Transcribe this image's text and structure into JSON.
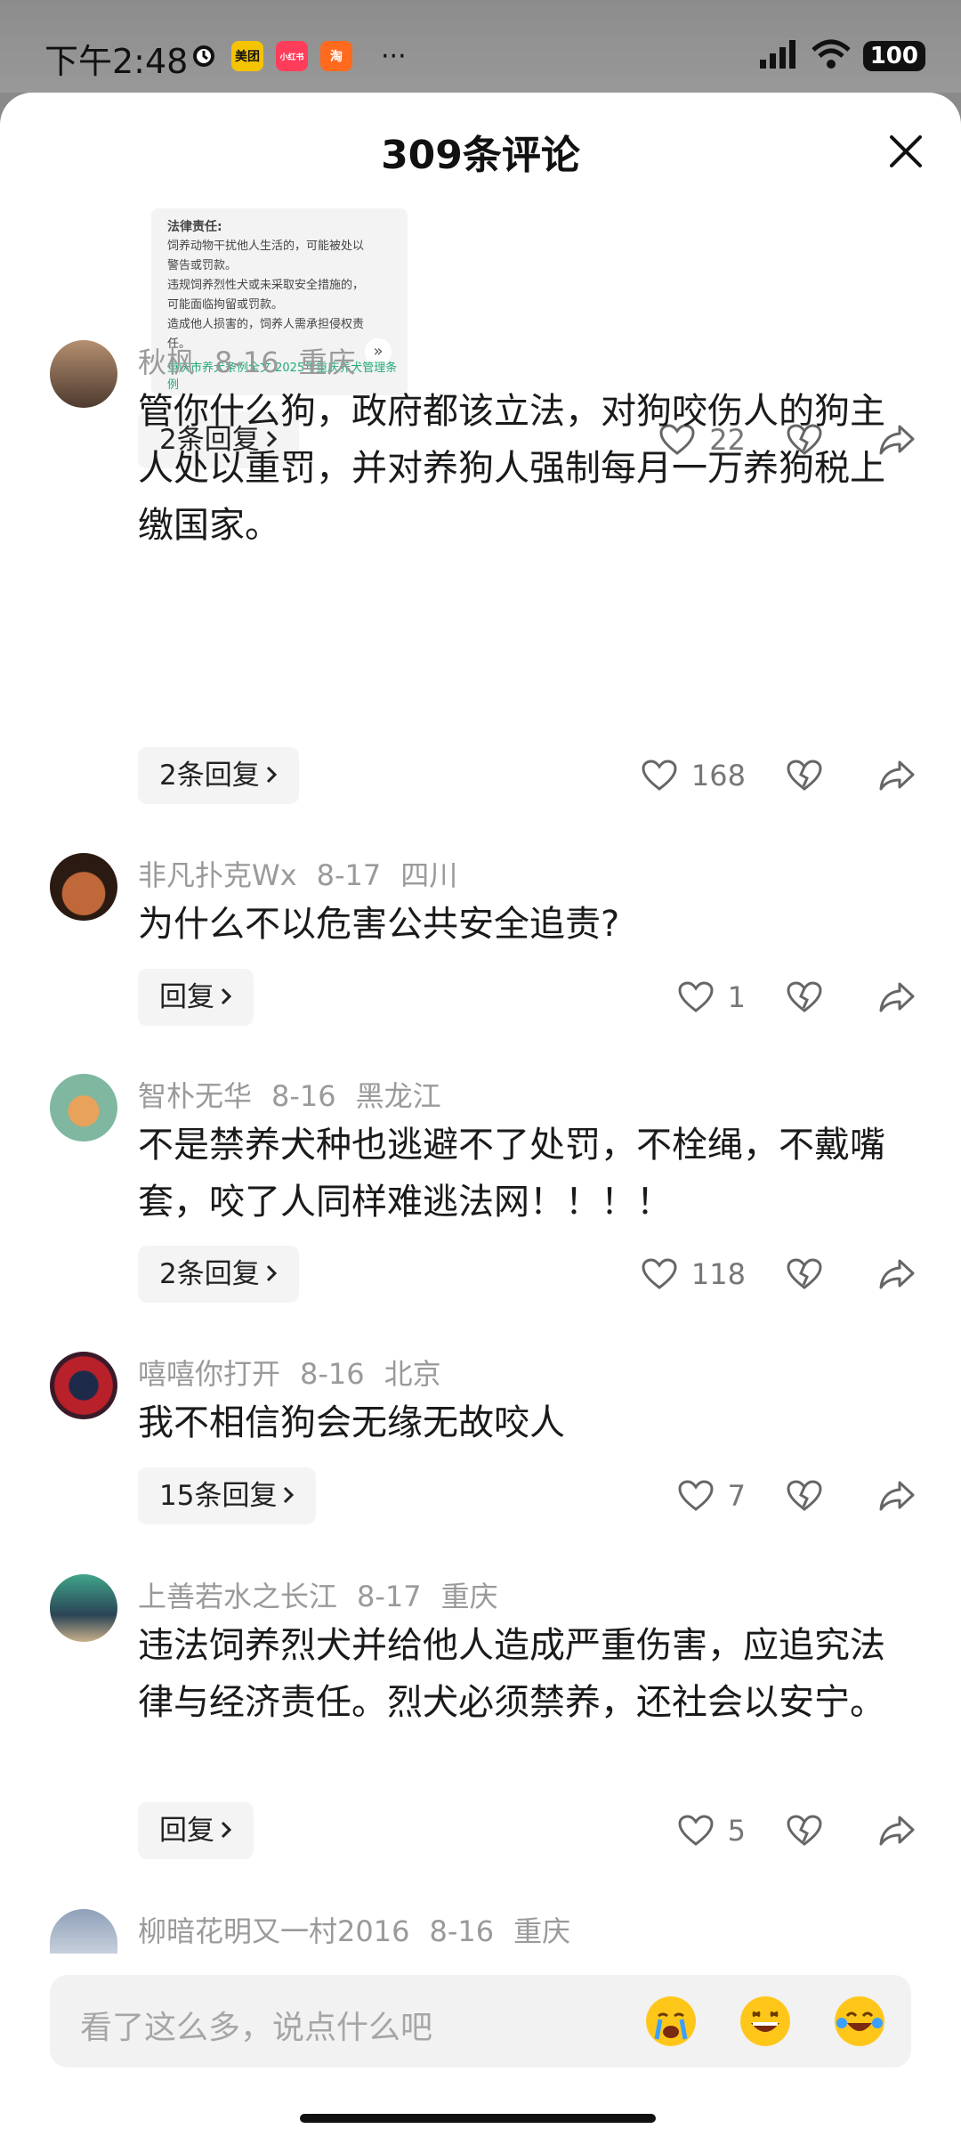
{
  "status_bar": {
    "time": "下午2:48",
    "apps": [
      "美团",
      "小红书",
      "淘"
    ],
    "more": "···",
    "battery": "100"
  },
  "sheet": {
    "title": "309条评论",
    "preview": {
      "heading": "法律责任:",
      "lines": [
        "饲养动物干扰他人生活的，可能被处以",
        "警告或罚款。",
        "违规饲养烈性犬或未采取安全措施的，",
        "可能面临拘留或罚款。",
        "造成他人损害的，饲养人需承担侵权责",
        "任。"
      ],
      "footer": "重庆市养犬条例全文   2025年重庆养犬管理条例"
    },
    "top_item": {
      "reply_label": "2条回复",
      "likes": "22"
    }
  },
  "comments": [
    {
      "user": "秋枫",
      "date": "8-16",
      "location": "重庆",
      "text": "管你什么狗，政府都该立法，对狗咬伤人的狗主人处以重罚，并对养狗人强制每月一万养狗税上缴国家。",
      "reply_label": "2条回复",
      "likes": "168"
    },
    {
      "user": "非凡扑克Wx",
      "date": "8-17",
      "location": "四川",
      "text": "为什么不以危害公共安全追责?",
      "reply_label": "回复",
      "likes": "1"
    },
    {
      "user": "智朴无华",
      "date": "8-16",
      "location": "黑龙江",
      "text": "不是禁养犬种也逃避不了处罚，不栓绳，不戴嘴套，咬了人同样难逃法网！！！！",
      "reply_label": "2条回复",
      "likes": "118"
    },
    {
      "user": "嘻嘻你打开",
      "date": "8-16",
      "location": "北京",
      "text": "我不相信狗会无缘无故咬人",
      "reply_label": "15条回复",
      "likes": "7"
    },
    {
      "user": "上善若水之长江",
      "date": "8-17",
      "location": "重庆",
      "text": "违法饲养烈犬并给他人造成严重伤害，应追究法律与经济责任。烈犬必须禁养，还社会以安宁。",
      "reply_label": "回复",
      "likes": "5"
    },
    {
      "user": "柳暗花明又一村2016",
      "date": "8-16",
      "location": "重庆"
    }
  ],
  "input": {
    "placeholder": "看了这么多，说点什么吧"
  },
  "colors": {
    "accent_text": "#1a1a1a",
    "meta_text": "#9a9a9a"
  }
}
